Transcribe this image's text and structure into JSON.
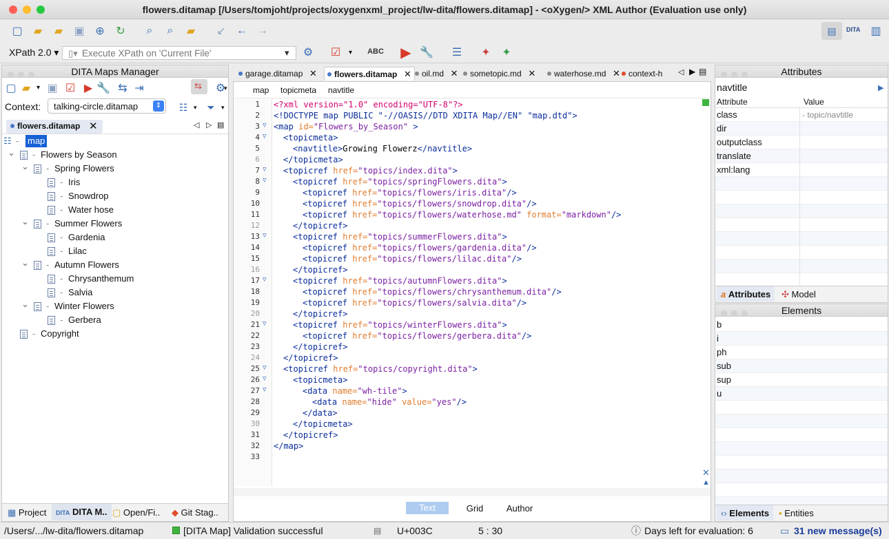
{
  "window": {
    "title": "flowers.ditamap [/Users/tomjoht/projects/oxygenxml_project/lw-dita/flowers.ditamap] - <oXygen/> XML Author (Evaluation use only)"
  },
  "xpath": {
    "version": "XPath 2.0",
    "placeholder": "Execute XPath on  'Current File'"
  },
  "maps_manager": {
    "title": "DITA Maps Manager",
    "context_label": "Context:",
    "context_value": "talking-circle.ditamap",
    "open_tab": "flowers.ditamap",
    "tree": [
      {
        "label": "map",
        "level": 0,
        "selected": true
      },
      {
        "label": "Flowers by Season",
        "level": 1
      },
      {
        "label": "Spring Flowers",
        "level": 2
      },
      {
        "label": "Iris",
        "level": 3
      },
      {
        "label": "Snowdrop",
        "level": 3
      },
      {
        "label": "Water hose",
        "level": 3
      },
      {
        "label": "Summer Flowers",
        "level": 2
      },
      {
        "label": "Gardenia",
        "level": 3
      },
      {
        "label": "Lilac",
        "level": 3
      },
      {
        "label": "Autumn Flowers",
        "level": 2
      },
      {
        "label": "Chrysanthemum",
        "level": 3
      },
      {
        "label": "Salvia",
        "level": 3
      },
      {
        "label": "Winter Flowers",
        "level": 2
      },
      {
        "label": "Gerbera",
        "level": 3
      },
      {
        "label": "Copyright",
        "level": 1
      }
    ],
    "bottom_tabs": [
      "Project",
      "DITA M..",
      "Open/Fi..",
      "Git Stag.."
    ]
  },
  "editor": {
    "tabs": [
      "garage.ditamap",
      "flowers.ditamap",
      "oil.md",
      "sometopic.md",
      "waterhose.md",
      "context-h"
    ],
    "breadcrumb": [
      "map",
      "topicmeta",
      "navtitle"
    ],
    "lines": [
      "1",
      "2",
      "3",
      "4",
      "5",
      "6",
      "7",
      "8",
      "9",
      "10",
      "11",
      "12",
      "13",
      "14",
      "15",
      "16",
      "17",
      "18",
      "19",
      "20",
      "21",
      "22",
      "23",
      "24",
      "25",
      "26",
      "27",
      "28",
      "29",
      "30",
      "31",
      "32",
      "33"
    ],
    "code": {
      "l1a": "<?xml version=\"1.0\" encoding=\"UTF-8\"?>",
      "l2": "<!DOCTYPE map PUBLIC \"-//OASIS//DTD XDITA Map//EN\" \"map.dtd\">",
      "map_open": "<map",
      "id_attr": " id=",
      "id_val": "\"Flowers_by_Season\"",
      "gt": " >",
      "topicmeta_open": "<topicmeta>",
      "navtitle_open": "<navtitle>",
      "navtitle_text": "Growing Flowerz",
      "navtitle_close": "</navtitle>",
      "topicmeta_close": "</topicmeta>",
      "topicref": "<topicref",
      "href": " href=",
      "close_sl": "/>",
      "close_gt": ">",
      "topicref_close": "</topicref>",
      "format": " format=",
      "format_val": "\"markdown\"",
      "v_index": "\"topics/index.dita\"",
      "v_spring": "\"topics/springFlowers.dita\"",
      "v_iris": "\"topics/flowers/iris.dita\"",
      "v_snow": "\"topics/flowers/snowdrop.dita\"",
      "v_water": "\"topics/flowers/waterhose.md\"",
      "v_summer": "\"topics/summerFlowers.dita\"",
      "v_gard": "\"topics/flowers/gardenia.dita\"",
      "v_lilac": "\"topics/flowers/lilac.dita\"",
      "v_autumn": "\"topics/autumnFlowers.dita\"",
      "v_chry": "\"topics/flowers/chrysanthemum.dita\"",
      "v_salvia": "\"topics/flowers/salvia.dita\"",
      "v_winter": "\"topics/winterFlowers.dita\"",
      "v_gerb": "\"topics/flowers/gerbera.dita\"",
      "v_copy": "\"topics/copyright.dita\"",
      "data": "<data",
      "name": " name=",
      "value": " value=",
      "v_whtile": "\"wh-tile\"",
      "v_hide": "\"hide\"",
      "v_yes": "\"yes\"",
      "data_close": "</data>",
      "map_close": "</map>"
    },
    "bottom_tabs": [
      "Text",
      "Grid",
      "Author"
    ]
  },
  "attributes": {
    "title": "Attributes",
    "element": "navtitle",
    "col_attr": "Attribute",
    "col_val": "Value",
    "rows": [
      {
        "name": "class",
        "value": "- topic/navtitle"
      },
      {
        "name": "dir",
        "value": ""
      },
      {
        "name": "outputclass",
        "value": ""
      },
      {
        "name": "translate",
        "value": ""
      },
      {
        "name": "xml:lang",
        "value": ""
      }
    ],
    "tabs": [
      "Attributes",
      "Model"
    ]
  },
  "elements": {
    "title": "Elements",
    "items": [
      "b",
      "i",
      "ph",
      "sub",
      "sup",
      "u"
    ],
    "tabs": [
      "Elements",
      "Entities"
    ]
  },
  "status": {
    "path": "/Users/.../lw-dita/flowers.ditamap",
    "validation": "[DITA Map] Validation successful",
    "unicode": "U+003C",
    "position": "5 : 30",
    "eval": "Days left for evaluation: 6",
    "messages": "31 new message(s)"
  }
}
